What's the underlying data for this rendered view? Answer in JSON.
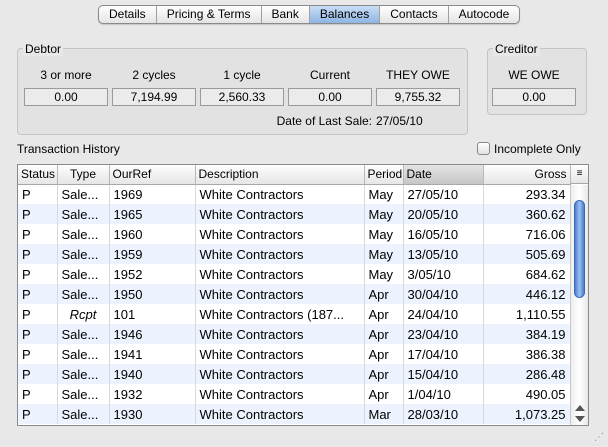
{
  "tabs": [
    {
      "label": "Details",
      "active": false
    },
    {
      "label": "Pricing & Terms",
      "active": false
    },
    {
      "label": "Bank",
      "active": false
    },
    {
      "label": "Balances",
      "active": true
    },
    {
      "label": "Contacts",
      "active": false
    },
    {
      "label": "Autocode",
      "active": false
    }
  ],
  "debtor": {
    "title": "Debtor",
    "cols": [
      {
        "label": "3 or more",
        "value": "0.00"
      },
      {
        "label": "2 cycles",
        "value": "7,194.99"
      },
      {
        "label": "1 cycle",
        "value": "2,560.33"
      },
      {
        "label": "Current",
        "value": "0.00"
      },
      {
        "label": "THEY OWE",
        "value": "9,755.32"
      }
    ],
    "last_sale_label": "Date of Last Sale:",
    "last_sale_value": "27/05/10"
  },
  "creditor": {
    "title": "Creditor",
    "label": "WE OWE",
    "value": "0.00"
  },
  "history": {
    "title": "Transaction History",
    "incomplete_label": "Incomplete Only",
    "columns": [
      "Status",
      "Type",
      "OurRef",
      "Description",
      "Period",
      "Date",
      "Gross"
    ],
    "rows": [
      [
        "P",
        "Sale...",
        "1969",
        "White Contractors",
        "May",
        "27/05/10",
        "293.34"
      ],
      [
        "P",
        "Sale...",
        "1965",
        "White Contractors",
        "May",
        "20/05/10",
        "360.62"
      ],
      [
        "P",
        "Sale...",
        "1960",
        "White Contractors",
        "May",
        "16/05/10",
        "716.06"
      ],
      [
        "P",
        "Sale...",
        "1959",
        "White Contractors",
        "May",
        "13/05/10",
        "505.69"
      ],
      [
        "P",
        "Sale...",
        "1952",
        "White Contractors",
        "May",
        "3/05/10",
        "684.62"
      ],
      [
        "P",
        "Sale...",
        "1950",
        "White Contractors",
        "Apr",
        "30/04/10",
        "446.12"
      ],
      [
        "P",
        "Rcpt",
        "101",
        "White Contractors (187...",
        "Apr",
        "24/04/10",
        "1,110.55"
      ],
      [
        "P",
        "Sale...",
        "1946",
        "White Contractors",
        "Apr",
        "23/04/10",
        "384.19"
      ],
      [
        "P",
        "Sale...",
        "1941",
        "White Contractors",
        "Apr",
        "17/04/10",
        "386.38"
      ],
      [
        "P",
        "Sale...",
        "1940",
        "White Contractors",
        "Apr",
        "15/04/10",
        "286.48"
      ],
      [
        "P",
        "Sale...",
        "1932",
        "White Contractors",
        "Apr",
        "1/04/10",
        "490.05"
      ],
      [
        "P",
        "Sale...",
        "1930",
        "White Contractors",
        "Mar",
        "28/03/10",
        "1,073.25"
      ]
    ]
  }
}
